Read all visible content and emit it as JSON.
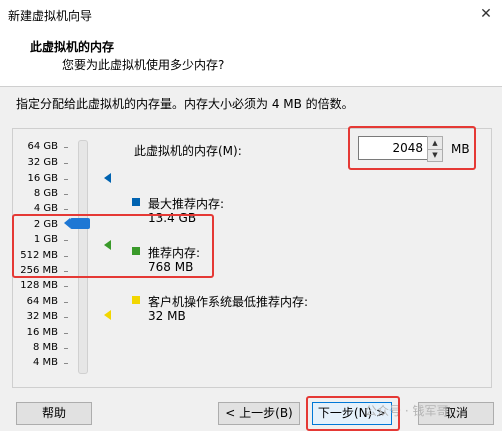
{
  "window": {
    "title": "新建虚拟机向导",
    "close_glyph": "✕"
  },
  "header": {
    "title": "此虚拟机的内存",
    "subtitle": "您要为此虚拟机使用多少内存?"
  },
  "description": "指定分配给此虚拟机的内存量。内存大小必须为 4 MB 的倍数。",
  "scale_labels": [
    "64 GB",
    "32 GB",
    "16 GB",
    "8 GB",
    "4 GB",
    "2 GB",
    "1 GB",
    "512 MB",
    "256 MB",
    "128 MB",
    "64 MB",
    "32 MB",
    "16 MB",
    "8 MB",
    "4 MB"
  ],
  "memory": {
    "label": "此虚拟机的内存(M):",
    "value": "2048",
    "unit": "MB",
    "spin_up": "▲",
    "spin_down": "▼"
  },
  "legend": {
    "max": {
      "label": "最大推荐内存:",
      "value": "13.4 GB",
      "color": "#0063b1"
    },
    "recommended": {
      "label": "推荐内存:",
      "value": "768 MB",
      "color": "#3a9a2a"
    },
    "min": {
      "label": "客户机操作系统最低推荐内存:",
      "value": "32 MB",
      "color": "#f2d600"
    }
  },
  "buttons": {
    "help": "帮助",
    "back": "< 上一步(B)",
    "next": "下一步(N) >",
    "cancel": "取消"
  },
  "watermark": "公众号 · 钱军哥"
}
